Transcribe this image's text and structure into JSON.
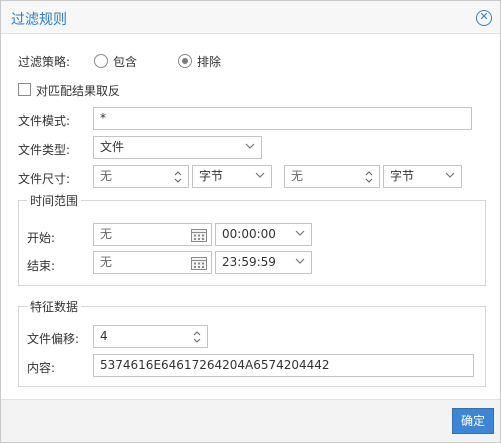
{
  "dialog": {
    "title": "过滤规则",
    "close_icon": "close-circle-icon"
  },
  "filter_policy": {
    "label": "过滤策略:",
    "options": [
      {
        "label": "包含",
        "checked": false
      },
      {
        "label": "排除",
        "checked": true
      }
    ]
  },
  "invert_match": {
    "label": "对匹配结果取反",
    "checked": false
  },
  "file_pattern": {
    "label": "文件模式:",
    "value": "*"
  },
  "file_type": {
    "label": "文件类型:",
    "value": "文件"
  },
  "file_size": {
    "label": "文件尺寸:",
    "min_value": "无",
    "min_unit": "字节",
    "max_value": "无",
    "max_unit": "字节"
  },
  "time_range": {
    "legend": "时间范围",
    "start_label": "开始:",
    "start_date": "无",
    "start_time": "00:00:00",
    "end_label": "结束:",
    "end_date": "无",
    "end_time": "23:59:59"
  },
  "signature": {
    "legend": "特征数据",
    "offset_label": "文件偏移:",
    "offset_value": "4",
    "content_label": "内容:",
    "content_value": "5374616E64617264204A6574204442"
  },
  "footer": {
    "ok_label": "确定"
  },
  "colors": {
    "accent": "#3c86d5",
    "title": "#2e7dc2"
  }
}
